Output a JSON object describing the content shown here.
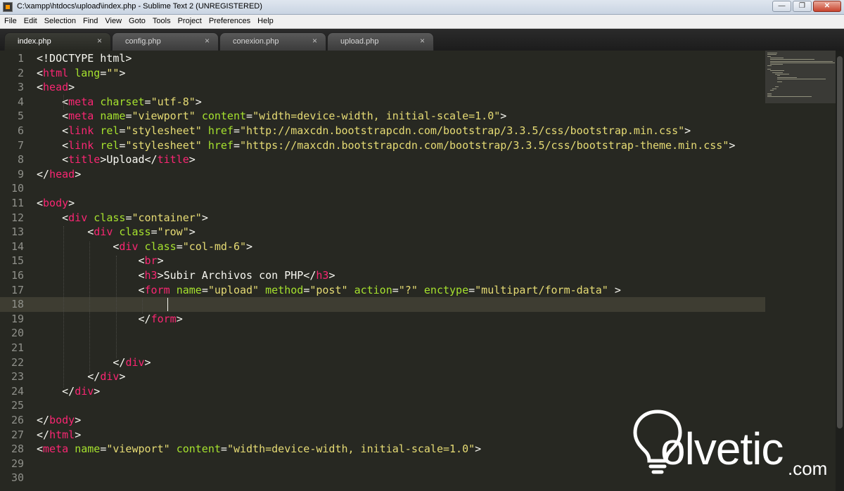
{
  "window": {
    "title": "C:\\xampp\\htdocs\\upload\\index.php - Sublime Text 2 (UNREGISTERED)",
    "minimize_icon": "minimize-icon",
    "maximize_icon": "maximize-icon",
    "close_icon": "close-icon"
  },
  "menu": [
    "File",
    "Edit",
    "Selection",
    "Find",
    "View",
    "Goto",
    "Tools",
    "Project",
    "Preferences",
    "Help"
  ],
  "tabs": [
    {
      "label": "index.php",
      "close": "×",
      "active": true
    },
    {
      "label": "config.php",
      "close": "×",
      "active": false
    },
    {
      "label": "conexion.php",
      "close": "×",
      "active": false
    },
    {
      "label": "upload.php",
      "close": "×",
      "active": false
    }
  ],
  "editor": {
    "current_line": 18,
    "colors": {
      "background": "#272822",
      "tag": "#f92672",
      "attribute": "#a6e22e",
      "string": "#e6db74",
      "text": "#f8f8f2",
      "line_number": "#8f908a"
    },
    "lines": [
      [
        [
          "",
          "<!DOCTYPE html>"
        ]
      ],
      [
        [
          "",
          "<"
        ],
        [
          "t",
          "html"
        ],
        [
          "",
          " "
        ],
        [
          "a",
          "lang"
        ],
        [
          "",
          "="
        ],
        [
          "s",
          "\"\""
        ],
        [
          "",
          ">"
        ]
      ],
      [
        [
          "",
          "<"
        ],
        [
          "t",
          "head"
        ],
        [
          "",
          ">"
        ]
      ],
      [
        [
          "",
          "    <"
        ],
        [
          "t",
          "meta"
        ],
        [
          "",
          " "
        ],
        [
          "a",
          "charset"
        ],
        [
          "",
          "="
        ],
        [
          "s",
          "\"utf-8\""
        ],
        [
          "",
          ">"
        ]
      ],
      [
        [
          "",
          "    <"
        ],
        [
          "t",
          "meta"
        ],
        [
          "",
          " "
        ],
        [
          "a",
          "name"
        ],
        [
          "",
          "="
        ],
        [
          "s",
          "\"viewport\""
        ],
        [
          "",
          " "
        ],
        [
          "a",
          "content"
        ],
        [
          "",
          "="
        ],
        [
          "s",
          "\"width=device-width, initial-scale=1.0\""
        ],
        [
          "",
          ">"
        ]
      ],
      [
        [
          "",
          "    <"
        ],
        [
          "t",
          "link"
        ],
        [
          "",
          " "
        ],
        [
          "a",
          "rel"
        ],
        [
          "",
          "="
        ],
        [
          "s",
          "\"stylesheet\""
        ],
        [
          "",
          " "
        ],
        [
          "a",
          "href"
        ],
        [
          "",
          "="
        ],
        [
          "s",
          "\"http://maxcdn.bootstrapcdn.com/bootstrap/3.3.5/css/bootstrap.min.css\""
        ],
        [
          "",
          ">"
        ]
      ],
      [
        [
          "",
          "    <"
        ],
        [
          "t",
          "link"
        ],
        [
          "",
          " "
        ],
        [
          "a",
          "rel"
        ],
        [
          "",
          "="
        ],
        [
          "s",
          "\"stylesheet\""
        ],
        [
          "",
          " "
        ],
        [
          "a",
          "href"
        ],
        [
          "",
          "="
        ],
        [
          "s",
          "\"https://maxcdn.bootstrapcdn.com/bootstrap/3.3.5/css/bootstrap-theme.min.css\""
        ],
        [
          "",
          ">"
        ]
      ],
      [
        [
          "",
          "    <"
        ],
        [
          "t",
          "title"
        ],
        [
          "",
          ">Upload</"
        ],
        [
          "t",
          "title"
        ],
        [
          "",
          ">"
        ]
      ],
      [
        [
          "",
          "</"
        ],
        [
          "t",
          "head"
        ],
        [
          "",
          ">"
        ]
      ],
      [],
      [
        [
          "",
          "<"
        ],
        [
          "t",
          "body"
        ],
        [
          "",
          ">"
        ]
      ],
      [
        [
          "",
          "    <"
        ],
        [
          "t",
          "div"
        ],
        [
          "",
          " "
        ],
        [
          "a",
          "class"
        ],
        [
          "",
          "="
        ],
        [
          "s",
          "\"container\""
        ],
        [
          "",
          ">"
        ]
      ],
      [
        [
          "",
          "        <"
        ],
        [
          "t",
          "div"
        ],
        [
          "",
          " "
        ],
        [
          "a",
          "class"
        ],
        [
          "",
          "="
        ],
        [
          "s",
          "\"row\""
        ],
        [
          "",
          ">"
        ]
      ],
      [
        [
          "",
          "            <"
        ],
        [
          "t",
          "div"
        ],
        [
          "",
          " "
        ],
        [
          "a",
          "class"
        ],
        [
          "",
          "="
        ],
        [
          "s",
          "\"col-md-6\""
        ],
        [
          "",
          ">"
        ]
      ],
      [
        [
          "",
          "                <"
        ],
        [
          "t",
          "br"
        ],
        [
          "",
          ">"
        ]
      ],
      [
        [
          "",
          "                <"
        ],
        [
          "t",
          "h3"
        ],
        [
          "",
          ">Subir Archivos con PHP</"
        ],
        [
          "t",
          "h3"
        ],
        [
          "",
          ">"
        ]
      ],
      [
        [
          "",
          "                <"
        ],
        [
          "t",
          "form"
        ],
        [
          "",
          " "
        ],
        [
          "a",
          "name"
        ],
        [
          "",
          "="
        ],
        [
          "s",
          "\"upload\""
        ],
        [
          "",
          " "
        ],
        [
          "a",
          "method"
        ],
        [
          "",
          "="
        ],
        [
          "s",
          "\"post\""
        ],
        [
          "",
          " "
        ],
        [
          "a",
          "action"
        ],
        [
          "",
          "="
        ],
        [
          "s",
          "\"?\""
        ],
        [
          "",
          " "
        ],
        [
          "a",
          "enctype"
        ],
        [
          "",
          "="
        ],
        [
          "s",
          "\"multipart/form-data\""
        ],
        [
          "",
          " >"
        ]
      ],
      [
        [
          "",
          "                    "
        ]
      ],
      [
        [
          "",
          "                </"
        ],
        [
          "t",
          "form"
        ],
        [
          "",
          ">"
        ]
      ],
      [],
      [],
      [
        [
          "",
          "            </"
        ],
        [
          "t",
          "div"
        ],
        [
          "",
          ">"
        ]
      ],
      [
        [
          "",
          "        </"
        ],
        [
          "t",
          "div"
        ],
        [
          "",
          ">"
        ]
      ],
      [
        [
          "",
          "    </"
        ],
        [
          "t",
          "div"
        ],
        [
          "",
          ">"
        ]
      ],
      [],
      [
        [
          "",
          "</"
        ],
        [
          "t",
          "body"
        ],
        [
          "",
          ">"
        ]
      ],
      [
        [
          "",
          "</"
        ],
        [
          "t",
          "html"
        ],
        [
          "",
          ">"
        ]
      ],
      [
        [
          "",
          "<"
        ],
        [
          "t",
          "meta"
        ],
        [
          "",
          " "
        ],
        [
          "a",
          "name"
        ],
        [
          "",
          "="
        ],
        [
          "s",
          "\"viewport\""
        ],
        [
          "",
          " "
        ],
        [
          "a",
          "content"
        ],
        [
          "",
          "="
        ],
        [
          "s",
          "\"width=device-width, initial-scale=1.0\""
        ],
        [
          "",
          ">"
        ]
      ],
      [],
      []
    ]
  },
  "watermark": {
    "brand": "olvetic",
    "suffix": ".com"
  }
}
